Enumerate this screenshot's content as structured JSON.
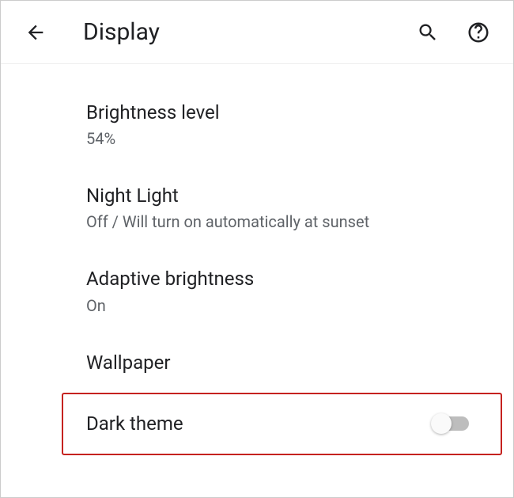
{
  "header": {
    "title": "Display"
  },
  "settings": [
    {
      "label": "Brightness level",
      "value": "54%"
    },
    {
      "label": "Night Light",
      "value": "Off / Will turn on automatically at sunset"
    },
    {
      "label": "Adaptive brightness",
      "value": "On"
    },
    {
      "label": "Wallpaper",
      "value": null
    },
    {
      "label": "Dark theme",
      "value": null,
      "toggle": false,
      "highlighted": true
    }
  ]
}
